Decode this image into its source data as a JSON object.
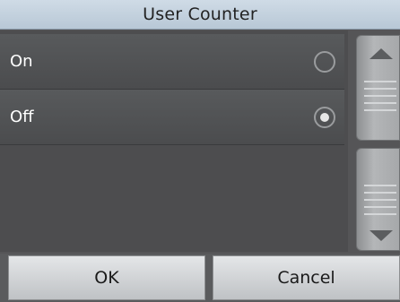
{
  "dialog": {
    "title": "User Counter"
  },
  "options": [
    {
      "label": "On",
      "selected": false
    },
    {
      "label": "Off",
      "selected": true
    }
  ],
  "buttons": {
    "ok_label": "OK",
    "cancel_label": "Cancel"
  },
  "icons": {
    "scroll_up": "arrow-up-icon",
    "scroll_down": "arrow-down-icon"
  }
}
